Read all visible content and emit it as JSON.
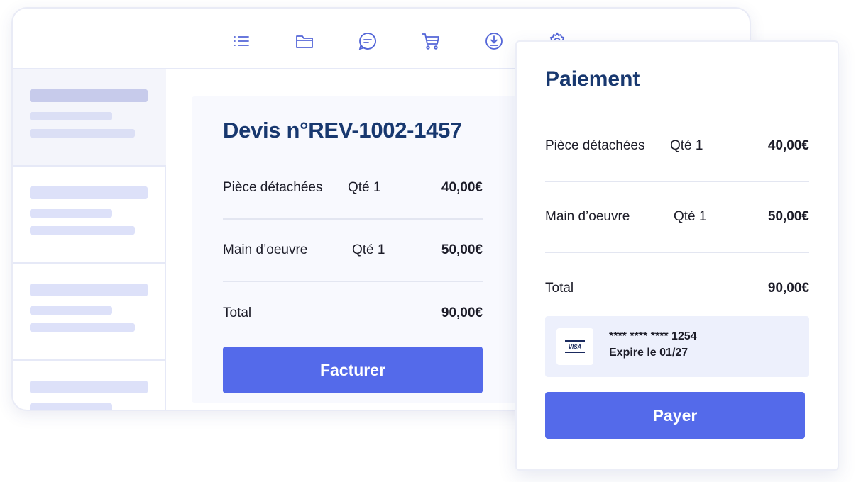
{
  "toolbar": {
    "icons": [
      "list-icon",
      "folder-icon",
      "chat-icon",
      "cart-icon",
      "download-icon",
      "gear-icon"
    ]
  },
  "quote": {
    "title": "Devis n°REV-1002-1457",
    "items": [
      {
        "name": "Pièce détachées",
        "qty": "Qté 1",
        "price": "40,00€"
      },
      {
        "name": "Main d’oeuvre",
        "qty": "Qté 1",
        "price": "50,00€"
      }
    ],
    "total_label": "Total",
    "total_value": "90,00€",
    "button_label": "Facturer"
  },
  "payment": {
    "title": "Paiement",
    "items": [
      {
        "name": "Pièce détachées",
        "qty": "Qté 1",
        "price": "40,00€"
      },
      {
        "name": "Main d’oeuvre",
        "qty": "Qté 1",
        "price": "50,00€"
      }
    ],
    "total_label": "Total",
    "total_value": "90,00€",
    "card": {
      "brand": "VISA",
      "number": "**** **** **** 1254",
      "expiry": "Expire le 01/27"
    },
    "button_label": "Payer"
  },
  "colors": {
    "accent": "#546aea",
    "title": "#18386f",
    "placeholder": "#dde1f9"
  }
}
